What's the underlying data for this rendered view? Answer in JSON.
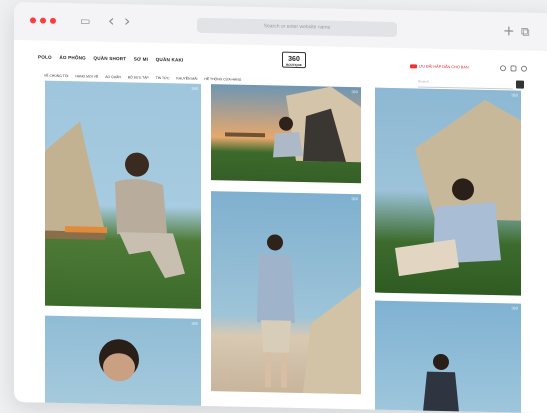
{
  "browser": {
    "address_placeholder": "Search or enter website name",
    "back_icon": "‹",
    "forward_icon": "›",
    "sidebar_icon": "▭",
    "new_tab_icon": "+",
    "tabs_icon": "⧉",
    "traffic_light_color": "#ff3b3b"
  },
  "nav_primary": [
    "POLO",
    "ÁO PHÔNG",
    "QUẦN SHORT",
    "SƠ MI",
    "QUẦN KAKI"
  ],
  "logo": {
    "mark": "360",
    "tag": "BOUTIQUE"
  },
  "promo_text": "ƯU ĐÃI HẤP DẪN CHO BẠN",
  "header_icons": [
    "user-icon",
    "bag-icon",
    "settings-icon"
  ],
  "nav_secondary": [
    "VỀ CHÚNG TÔI",
    "HÀNG MỚI VỀ",
    "ÁO QUẦN",
    "BỘ SƯU TẬP",
    "TIN TỨC",
    "KHUYẾN MÃI",
    "HỆ THỐNG CỬA HÀNG"
  ],
  "search_placeholder": "Search",
  "photo_badge": "360",
  "colors": {
    "sky": "#8cbcd6",
    "grass": "#3e6b2e",
    "sunset": "#e4a467",
    "tent": "#c9b79a"
  }
}
